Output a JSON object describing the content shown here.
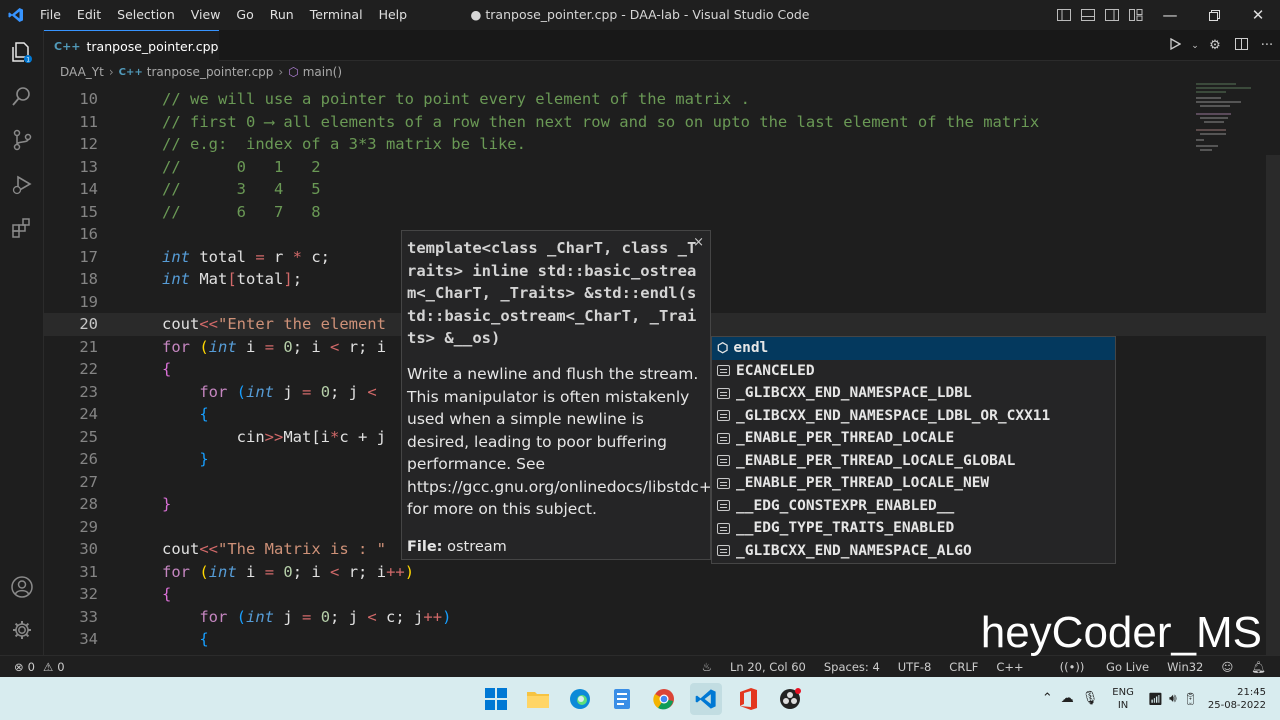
{
  "menu": [
    "File",
    "Edit",
    "Selection",
    "View",
    "Go",
    "Run",
    "Terminal",
    "Help"
  ],
  "window_title": "● tranpose_pointer.cpp - DAA-lab - Visual Studio Code",
  "tab": {
    "icon": "C++",
    "label": "tranpose_pointer.cpp"
  },
  "breadcrumb": {
    "folder": "DAA_Yt",
    "file": "tranpose_pointer.cpp",
    "symbol": "main()"
  },
  "code_lines": [
    {
      "n": "10"
    },
    {
      "n": "11"
    },
    {
      "n": "12"
    },
    {
      "n": "13"
    },
    {
      "n": "14"
    },
    {
      "n": "15"
    },
    {
      "n": "16"
    },
    {
      "n": "17"
    },
    {
      "n": "18"
    },
    {
      "n": "19"
    },
    {
      "n": "20"
    },
    {
      "n": "21"
    },
    {
      "n": "22"
    },
    {
      "n": "23"
    },
    {
      "n": "24"
    },
    {
      "n": "25"
    },
    {
      "n": "26"
    },
    {
      "n": "27"
    },
    {
      "n": "28"
    },
    {
      "n": "29"
    },
    {
      "n": "30"
    },
    {
      "n": "31"
    },
    {
      "n": "32"
    },
    {
      "n": "33"
    },
    {
      "n": "34"
    }
  ],
  "code": {
    "l10": "// we will use a pointer to point every element of the matrix .",
    "l11": "// first 0 ⟶ all elements of a row then next row and so on upto the last element of the matrix",
    "l12": "// e.g:  index of a 3*3 matrix be like.",
    "l13": "//      0   1   2",
    "l14": "//      3   4   5",
    "l15": "//      6   7   8",
    "int": "int",
    "total_decl": " total ",
    "eq": "=",
    "r": " r ",
    "star": "*",
    "c_semi": " c;",
    "mat_decl": " Mat",
    "total_in": "total",
    "semi": ";",
    "cout": "cout",
    "shl": "<<",
    "enter_str": "\"Enter the element",
    "for": "for",
    "i_init": " i ",
    "zero": "0",
    "i_lt_r": "; i ",
    "lt": "<",
    "r_semi_i": " r; i",
    "brace_open": "{",
    "brace_close": "}",
    "j_init": " j ",
    "j_lt": "; j ",
    "cin": "cin",
    "shr": ">>",
    "mat_idx": "Mat[",
    "i_": "i",
    "c_plus_j": "c + j",
    "matrix_str": "\"The Matrix is : \"",
    "r_semi_ipp": " r; i",
    "pp": "++",
    "rp": ")",
    "c_semi_j": " c; j"
  },
  "hover": {
    "signature": "template<class _CharT, class _Traits> inline std::basic_ostream<_CharT, _Traits> &std::endl(std::basic_ostream<_CharT, _Traits> &__os)",
    "close": "×",
    "doc": "Write a newline and flush the stream. This manipulator is often mistakenly used when a simple newline is desired, leading to poor buffering performance. See https://gcc.gnu.org/onlinedocs/libstdc++ for more on this subject.",
    "file_label": "File:",
    "file_value": "ostream"
  },
  "suggestions": [
    "endl",
    "ECANCELED",
    "_GLIBCXX_END_NAMESPACE_LDBL",
    "_GLIBCXX_END_NAMESPACE_LDBL_OR_CXX11",
    "_ENABLE_PER_THREAD_LOCALE",
    "_ENABLE_PER_THREAD_LOCALE_GLOBAL",
    "_ENABLE_PER_THREAD_LOCALE_NEW",
    "__EDG_CONSTEXPR_ENABLED__",
    "__EDG_TYPE_TRAITS_ENABLED",
    "_GLIBCXX_END_NAMESPACE_ALGO"
  ],
  "status": {
    "errors": "0",
    "warnings": "0",
    "position": "Ln 20, Col 60",
    "spaces": "Spaces: 4",
    "encoding": "UTF-8",
    "eol": "CRLF",
    "language": "C++",
    "golive": "Go Live",
    "platform": "Win32"
  },
  "tray": {
    "lang": "ENG",
    "region": "IN",
    "time": "21:45",
    "date": "25-08-2022"
  },
  "watermark": "heyCoder_MS",
  "colors": {
    "accent": "#3794ff",
    "taskbar": "#d8ecef"
  }
}
